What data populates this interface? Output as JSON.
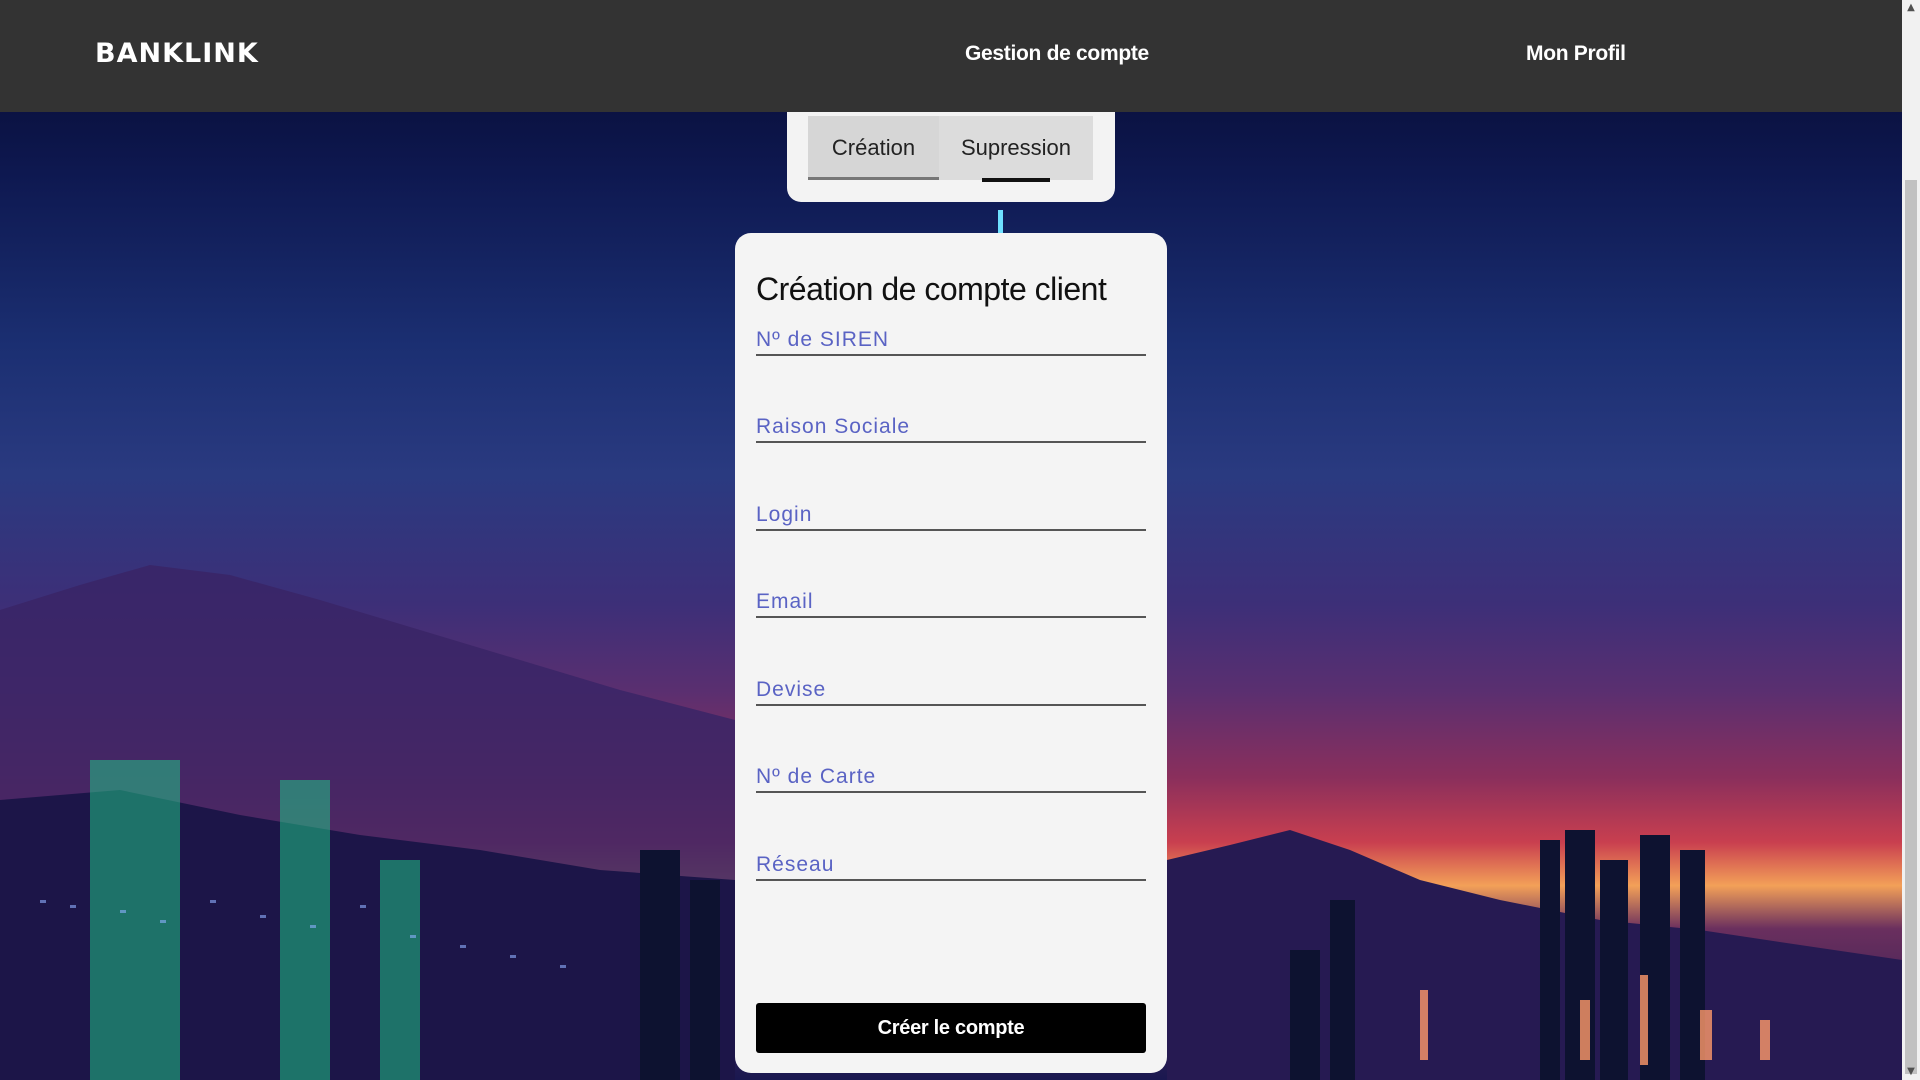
{
  "brand": {
    "logo": "BANKLINK"
  },
  "nav": {
    "account_management": "Gestion de compte",
    "profile": "Mon Profil"
  },
  "tabs": {
    "create": "Création",
    "delete": "Supression"
  },
  "form": {
    "title": "Création de compte client",
    "fields": [
      {
        "placeholder": "Nº de SIREN",
        "value": ""
      },
      {
        "placeholder": "Raison Sociale",
        "value": ""
      },
      {
        "placeholder": "Login",
        "value": ""
      },
      {
        "placeholder": "Email",
        "value": ""
      },
      {
        "placeholder": "Devise",
        "value": ""
      },
      {
        "placeholder": "Nº de Carte",
        "value": ""
      },
      {
        "placeholder": "Réseau",
        "value": ""
      }
    ],
    "submit_label": "Créer le compte"
  },
  "colors": {
    "navbar": "#333333",
    "card": "#f4f4f4",
    "field_text": "#5a63c4",
    "button": "#000000"
  }
}
